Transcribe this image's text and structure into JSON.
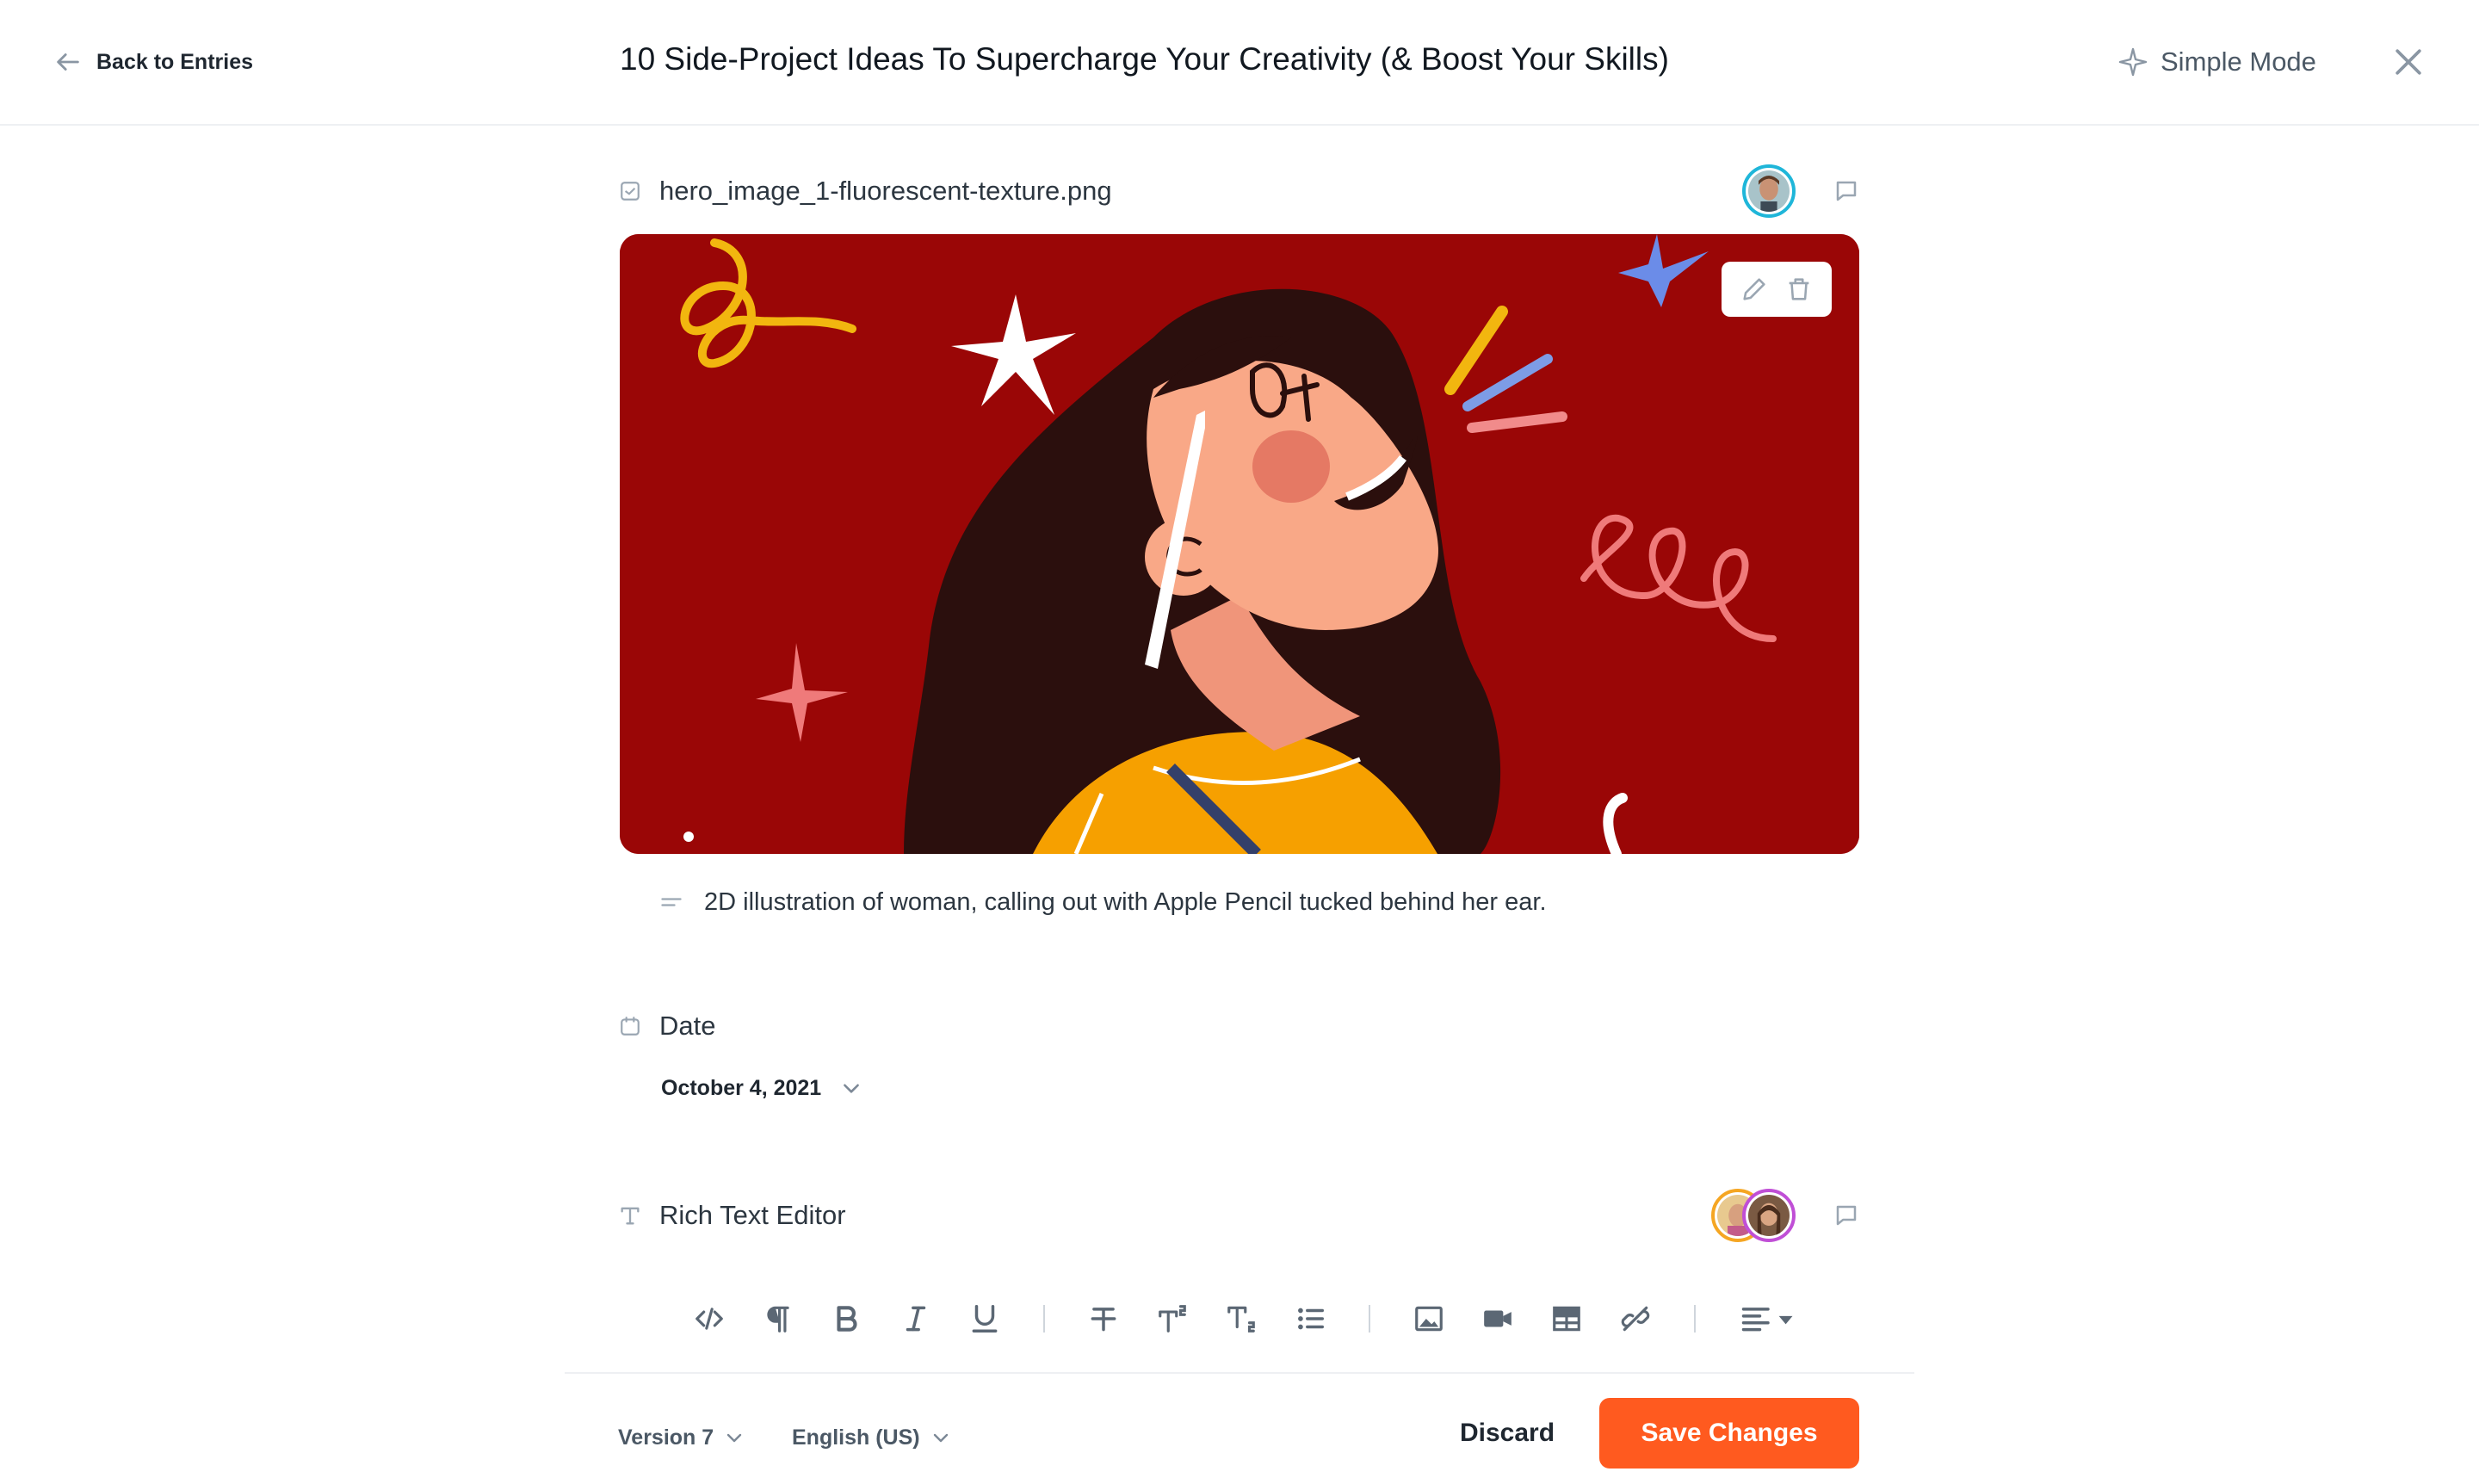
{
  "header": {
    "back_label": "Back to Entries",
    "title": "10 Side-Project Ideas To Supercharge Your Creativity (& Boost Your Skills)",
    "simple_mode_label": "Simple Mode"
  },
  "image_field": {
    "filename": "hero_image_1-fluorescent-texture.png",
    "caption": "2D illustration of woman, calling out with Apple Pencil tucked behind her ear."
  },
  "date_field": {
    "label": "Date",
    "value": "October 4, 2021"
  },
  "rich_text_field": {
    "label": "Rich Text Editor"
  },
  "toolbar": {
    "buttons": [
      "code-icon",
      "paragraph-icon",
      "bold-icon",
      "italic-icon",
      "underline-icon",
      "strikethrough-icon",
      "superscript-icon",
      "subscript-icon",
      "bullet-list-icon",
      "image-icon",
      "video-icon",
      "table-icon",
      "unlink-icon",
      "align-left-icon"
    ]
  },
  "footer": {
    "version_label": "Version 7",
    "language_label": "English (US)",
    "discard_label": "Discard",
    "save_label": "Save Changes"
  },
  "colors": {
    "accent": "#ff5a1f",
    "hero_background": "#9a0606",
    "avatar_ring": "#1fb6d9",
    "icon_gray": "#8a96a3"
  }
}
